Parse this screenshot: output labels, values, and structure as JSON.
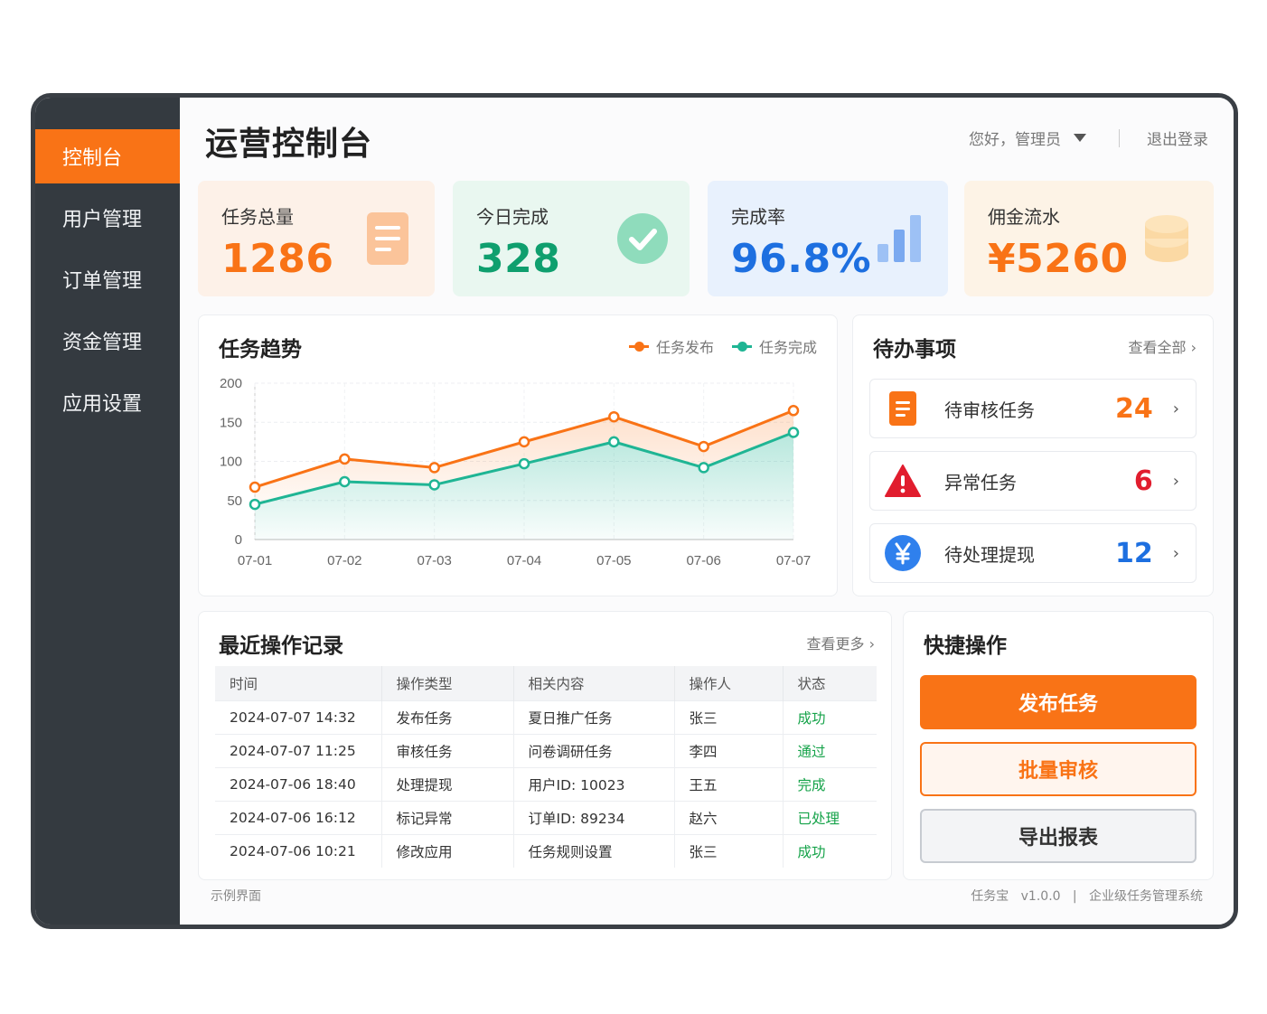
{
  "sidebar": {
    "items": [
      {
        "label": "控制台"
      },
      {
        "label": "用户管理"
      },
      {
        "label": "订单管理"
      },
      {
        "label": "资金管理"
      },
      {
        "label": "应用设置"
      }
    ]
  },
  "header": {
    "title": "运营控制台",
    "greeting": "您好，管理员",
    "logout": "退出登录"
  },
  "stats": [
    {
      "label": "任务总量",
      "value": "1286",
      "color": "#f97316",
      "icon": "document-icon"
    },
    {
      "label": "今日完成",
      "value": "328",
      "color": "#0f9f6e",
      "icon": "check-circle-icon"
    },
    {
      "label": "完成率",
      "value": "96.8%",
      "color": "#1d6fe0",
      "icon": "bar-chart-icon"
    },
    {
      "label": "佣金流水",
      "value": "¥5260",
      "color": "#f97316",
      "icon": "coin-stack-icon"
    }
  ],
  "trend": {
    "title": "任务趋势",
    "legend": [
      "任务发布",
      "任务完成"
    ]
  },
  "chart_data": {
    "type": "line",
    "categories": [
      "07-01",
      "07-02",
      "07-03",
      "07-04",
      "07-05",
      "07-06",
      "07-07"
    ],
    "series": [
      {
        "name": "任务发布",
        "values": [
          67,
          103,
          92,
          125,
          157,
          119,
          165
        ],
        "color": "#f97316"
      },
      {
        "name": "任务完成",
        "values": [
          45,
          74,
          70,
          97,
          125,
          92,
          137
        ],
        "color": "#1fb594"
      }
    ],
    "yticks": [
      "200",
      "150",
      "100",
      "50",
      "0"
    ],
    "ylim": [
      0,
      200
    ],
    "grid": true,
    "legend_position": "top-right"
  },
  "todo": {
    "title": "待办事项",
    "view_all": "查看全部",
    "items": [
      {
        "label": "待审核任务",
        "count": "24",
        "color": "#f97316",
        "icon": "document-icon"
      },
      {
        "label": "异常任务",
        "count": "6",
        "color": "#e11d2e",
        "icon": "warning-icon"
      },
      {
        "label": "待处理提现",
        "count": "12",
        "color": "#1d6fe0",
        "icon": "yen-icon"
      }
    ]
  },
  "records": {
    "title": "最近操作记录",
    "view_more": "查看更多",
    "columns": [
      "时间",
      "操作类型",
      "相关内容",
      "操作人",
      "状态"
    ],
    "rows": [
      [
        "2024-07-07 14:32",
        "发布任务",
        "夏日推广任务",
        "张三",
        "成功"
      ],
      [
        "2024-07-07 11:25",
        "审核任务",
        "问卷调研任务",
        "李四",
        "通过"
      ],
      [
        "2024-07-06 18:40",
        "处理提现",
        "用户ID: 10023",
        "王五",
        "完成"
      ],
      [
        "2024-07-06 16:12",
        "标记异常",
        "订单ID: 89234",
        "赵六",
        "已处理"
      ],
      [
        "2024-07-06 10:21",
        "修改应用",
        "任务规则设置",
        "张三",
        "成功"
      ]
    ]
  },
  "quick": {
    "title": "快捷操作",
    "publish": "发布任务",
    "batch_review": "批量审核",
    "export": "导出报表"
  },
  "footer": {
    "left": "示例界面",
    "app": "任务宝",
    "version": "v1.0.0",
    "divider": "|",
    "desc": "企业级任务管理系统"
  }
}
